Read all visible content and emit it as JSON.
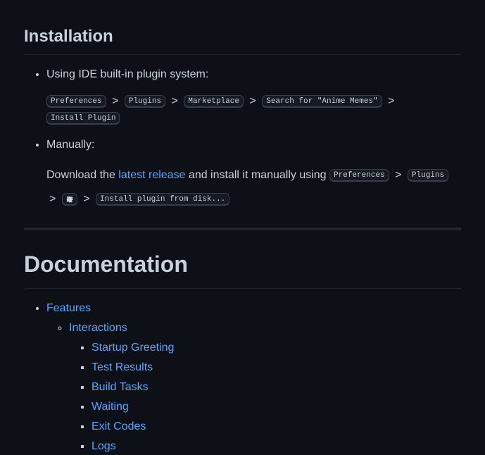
{
  "installation": {
    "heading": "Installation",
    "method1_label": "Using IDE built-in plugin system:",
    "steps": {
      "preferences": "Preferences",
      "plugins": "Plugins",
      "marketplace": "Marketplace",
      "search": "Search for \"Anime Memes\"",
      "install": "Install Plugin"
    },
    "method2_label": "Manually:",
    "manual_prefix": "Download the ",
    "manual_link": "latest release",
    "manual_suffix": " and install it manually using ",
    "install_from_disk": "Install plugin from disk...",
    "separator": ">",
    "gear_icon_name": "gear"
  },
  "documentation": {
    "heading": "Documentation",
    "links": {
      "features": "Features",
      "interactions": "Interactions",
      "startup_greeting": "Startup Greeting",
      "test_results": "Test Results",
      "build_tasks": "Build Tasks",
      "waiting": "Waiting",
      "exit_codes": "Exit Codes",
      "logs": "Logs"
    }
  }
}
